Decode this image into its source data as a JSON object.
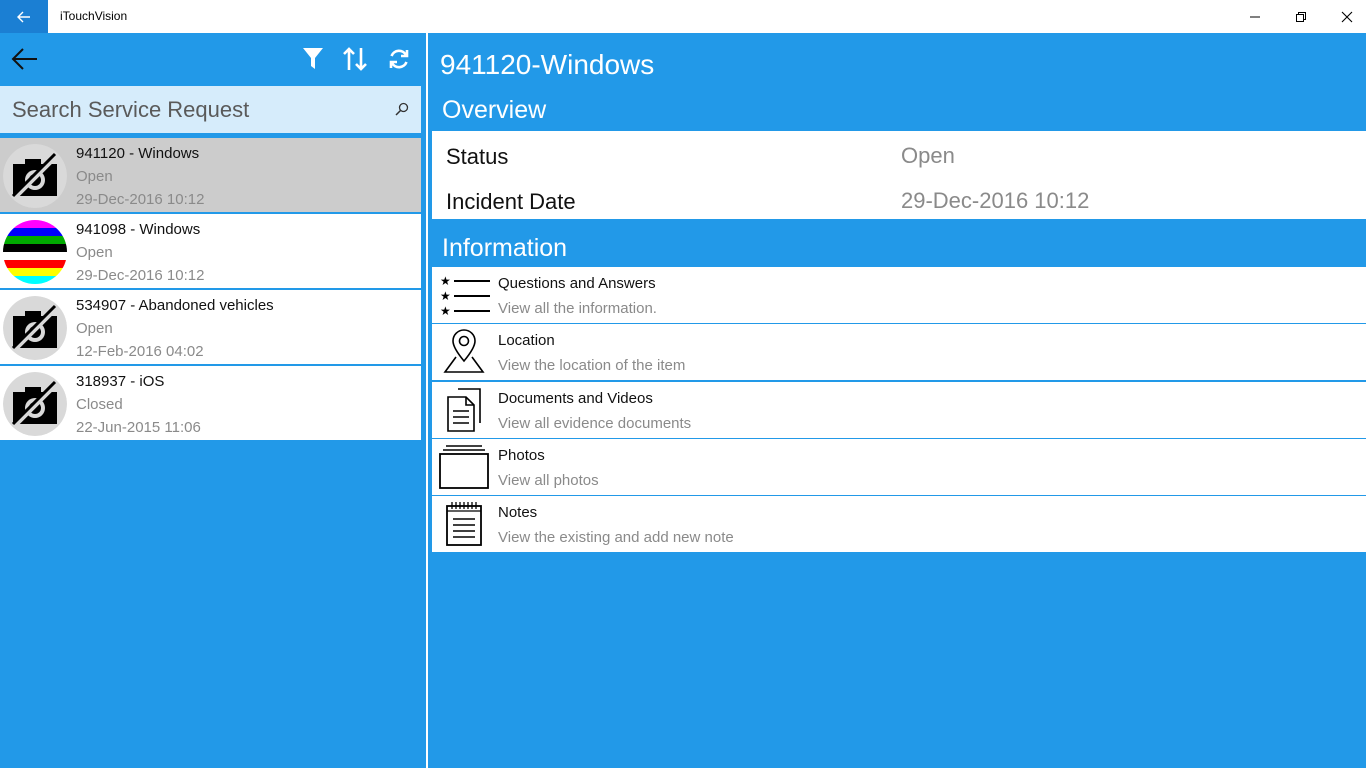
{
  "window": {
    "title": "iTouchVision"
  },
  "search": {
    "placeholder": "Search Service Request"
  },
  "requests": [
    {
      "title": "941120 - Windows",
      "status": "Open",
      "date": "29-Dec-2016 10:12",
      "thumb": "no-photo-icon",
      "selected": true
    },
    {
      "title": "941098 - Windows",
      "status": "Open",
      "date": "29-Dec-2016 10:12",
      "thumb": "color-stripes-image",
      "selected": false
    },
    {
      "title": "534907 - Abandoned vehicles",
      "status": "Open",
      "date": "12-Feb-2016 04:02",
      "thumb": "no-photo-icon",
      "selected": false
    },
    {
      "title": "318937 - iOS",
      "status": "Closed",
      "date": "22-Jun-2015 11:06",
      "thumb": "no-photo-icon",
      "selected": false
    }
  ],
  "detail": {
    "title": "941120-Windows",
    "overview_header": "Overview",
    "status_label": "Status",
    "status_value": "Open",
    "incident_label": "Incident Date",
    "incident_value": "29-Dec-2016 10:12",
    "information_header": "Information"
  },
  "information": [
    {
      "title": "Questions and Answers",
      "subtitle": "View all the information.",
      "icon": "starred-list-icon"
    },
    {
      "title": "Location",
      "subtitle": "View the location of the item",
      "icon": "map-pin-icon"
    },
    {
      "title": "Documents and Videos",
      "subtitle": "View all evidence documents",
      "icon": "documents-icon"
    },
    {
      "title": "Photos",
      "subtitle": "View all photos",
      "icon": "photo-stack-icon"
    },
    {
      "title": "Notes",
      "subtitle": "View the existing and add new note",
      "icon": "notepad-icon"
    }
  ],
  "colors": {
    "accent": "#2299e8",
    "titlebar_back": "#1b7fd3",
    "selected_row": "#cccccc",
    "search_bg": "#d6ecfb"
  }
}
